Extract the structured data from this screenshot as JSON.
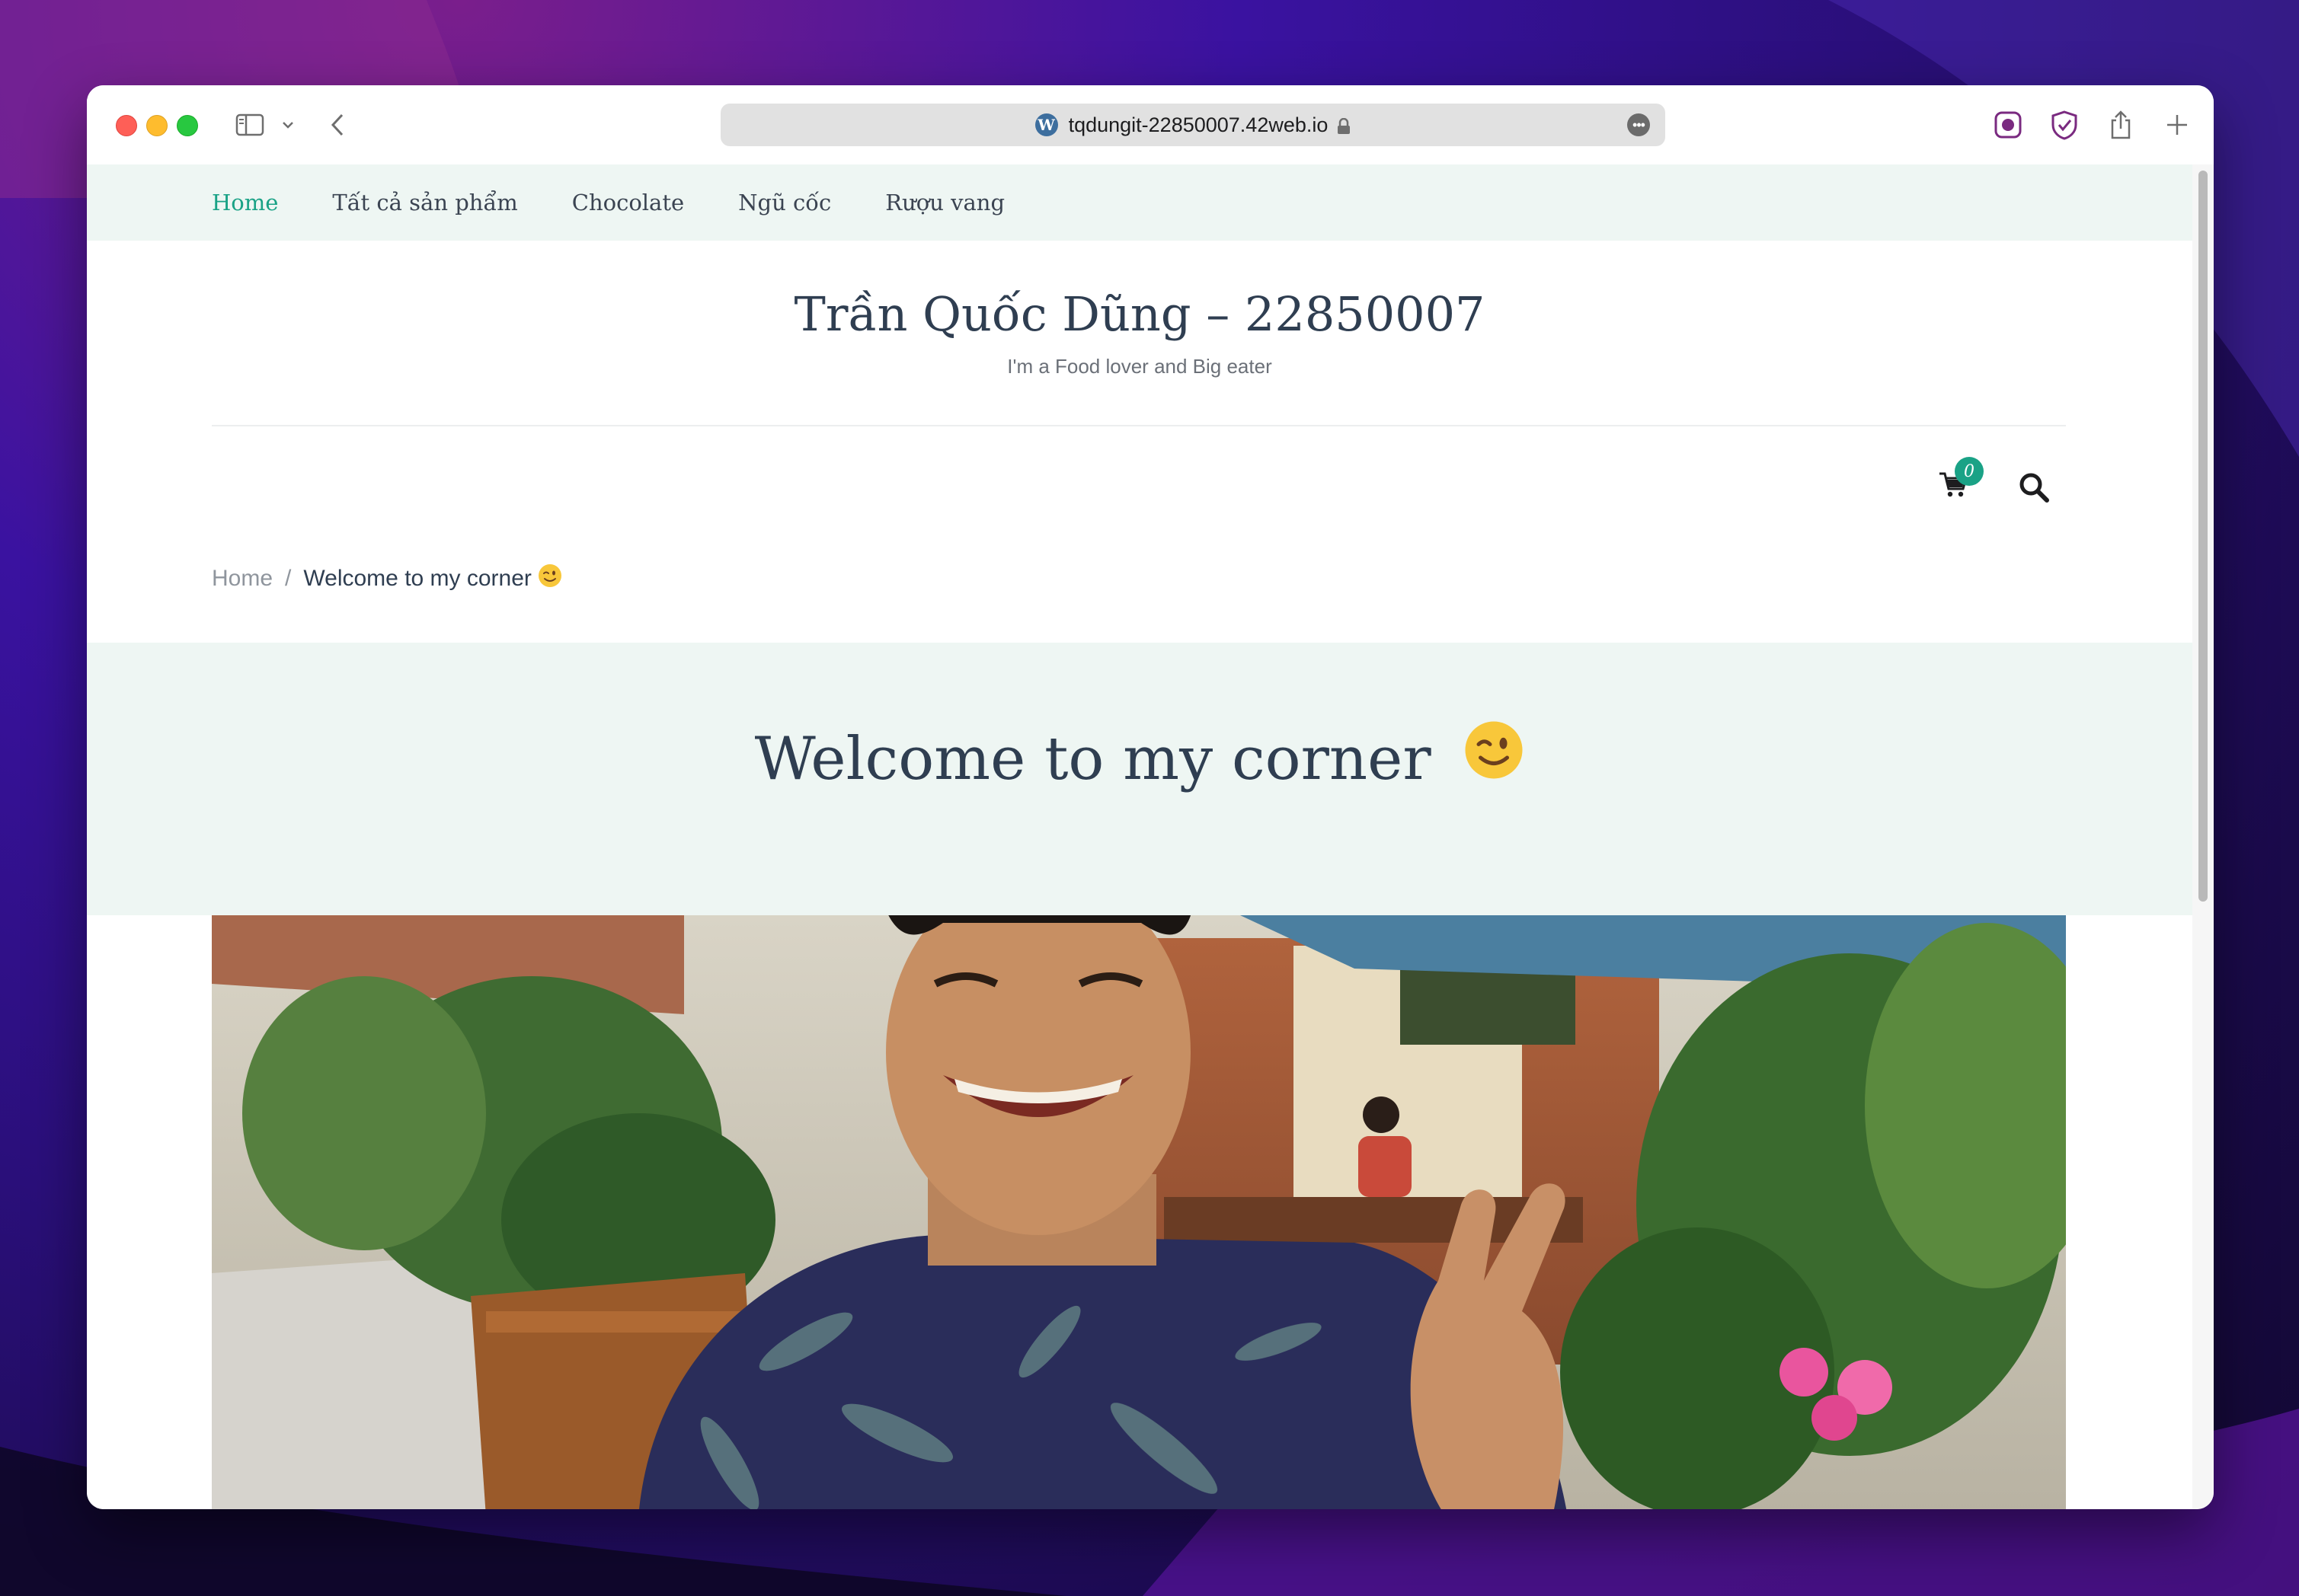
{
  "browser": {
    "url": "tqdungit-22850007.42web.io",
    "site_icon": "wordpress-icon"
  },
  "nav": {
    "items": [
      {
        "label": "Home",
        "active": true
      },
      {
        "label": "Tất cả sản phẩm",
        "active": false
      },
      {
        "label": "Chocolate",
        "active": false
      },
      {
        "label": "Ngũ cốc",
        "active": false
      },
      {
        "label": "Rượu vang",
        "active": false
      }
    ]
  },
  "site": {
    "title": "Trần Quốc Dũng – 22850007",
    "tagline": "I'm a Food lover and Big eater"
  },
  "header_tools": {
    "cart_count": "0",
    "cart_icon": "cart-icon",
    "search_icon": "search-icon"
  },
  "breadcrumb": {
    "home": "Home",
    "separator": "/",
    "current": "Welcome to my corner"
  },
  "page": {
    "title": "Welcome to my corner"
  },
  "colors": {
    "accent": "#1aa286",
    "heading": "#2f3e51",
    "nav_bg": "#eef6f3"
  }
}
